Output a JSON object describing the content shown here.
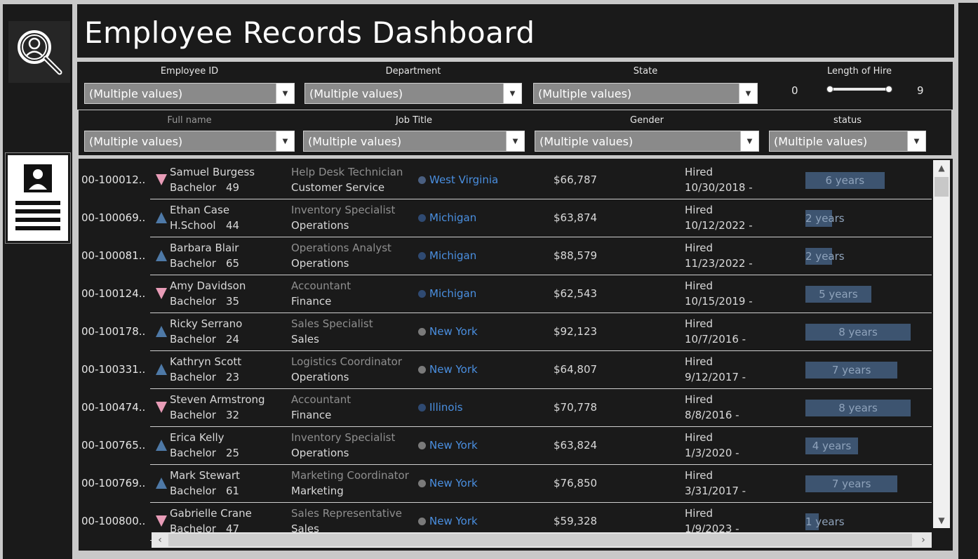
{
  "title": "Employee Records Dashboard",
  "filters": {
    "employee_id": {
      "label": "Employee ID",
      "value": "(Multiple values)"
    },
    "department": {
      "label": "Department",
      "value": "(Multiple values)"
    },
    "state": {
      "label": "State",
      "value": "(Multiple values)"
    },
    "length_of_hire": {
      "label": "Length of Hire",
      "min": "0",
      "max": "9",
      "range_fraction": [
        0,
        1
      ]
    },
    "full_name": {
      "label": "Full name",
      "value": "(Multiple values)"
    },
    "job_title": {
      "label": "Job Title",
      "value": "(Multiple values)"
    },
    "gender": {
      "label": "Gender",
      "value": "(Multiple values)"
    },
    "status": {
      "label": "status",
      "value": "(Multiple values)"
    }
  },
  "colors": {
    "male": "#4e79a7",
    "female": "#e89cb7",
    "state_link": "#4a8fe0",
    "bar": "#3d5470"
  },
  "rows": [
    {
      "id": "00-100012..",
      "gender": "female",
      "name": "Samuel Burgess",
      "edu": "Bachelor",
      "age": "49",
      "job": "Help Desk Technician",
      "dept": "Customer Service",
      "state": "West Virginia",
      "dot": "#4a5f80",
      "salary": "$66,787",
      "status": "Hired",
      "date": "10/30/2018 -",
      "tenure": "6 years",
      "tenure_val": 6
    },
    {
      "id": "00-100069..",
      "gender": "male",
      "name": "Ethan Case",
      "edu": "H.School",
      "age": "44",
      "job": "Inventory Specialist",
      "dept": "Operations",
      "state": "Michigan",
      "dot": "#2f4a72",
      "salary": "$63,874",
      "status": "Hired",
      "date": "10/12/2022 -",
      "tenure": "2 years",
      "tenure_val": 2
    },
    {
      "id": "00-100081..",
      "gender": "male",
      "name": "Barbara Blair",
      "edu": "Bachelor",
      "age": "65",
      "job": "Operations Analyst",
      "dept": "Operations",
      "state": "Michigan",
      "dot": "#2f4a72",
      "salary": "$88,579",
      "status": "Hired",
      "date": "11/23/2022 -",
      "tenure": "2 years",
      "tenure_val": 2
    },
    {
      "id": "00-100124..",
      "gender": "female",
      "name": "Amy Davidson",
      "edu": "Bachelor",
      "age": "35",
      "job": "Accountant",
      "dept": "Finance",
      "state": "Michigan",
      "dot": "#2f4a72",
      "salary": "$62,543",
      "status": "Hired",
      "date": "10/15/2019 -",
      "tenure": "5 years",
      "tenure_val": 5
    },
    {
      "id": "00-100178..",
      "gender": "male",
      "name": "Ricky Serrano",
      "edu": "Bachelor",
      "age": "24",
      "job": "Sales Specialist",
      "dept": "Sales",
      "state": "New York",
      "dot": "#7a7a7a",
      "salary": "$92,123",
      "status": "Hired",
      "date": "10/7/2016 -",
      "tenure": "8 years",
      "tenure_val": 8
    },
    {
      "id": "00-100331..",
      "gender": "male",
      "name": "Kathryn Scott",
      "edu": "Bachelor",
      "age": "23",
      "job": "Logistics Coordinator",
      "dept": "Operations",
      "state": "New York",
      "dot": "#7a7a7a",
      "salary": "$64,807",
      "status": "Hired",
      "date": "9/12/2017 -",
      "tenure": "7 years",
      "tenure_val": 7
    },
    {
      "id": "00-100474..",
      "gender": "female",
      "name": "Steven Armstrong",
      "edu": "Bachelor",
      "age": "32",
      "job": "Accountant",
      "dept": "Finance",
      "state": "Illinois",
      "dot": "#2f4a72",
      "salary": "$70,778",
      "status": "Hired",
      "date": "8/8/2016 -",
      "tenure": "8 years",
      "tenure_val": 8
    },
    {
      "id": "00-100765..",
      "gender": "male",
      "name": "Erica Kelly",
      "edu": "Bachelor",
      "age": "25",
      "job": "Inventory Specialist",
      "dept": "Operations",
      "state": "New York",
      "dot": "#7a7a7a",
      "salary": "$63,824",
      "status": "Hired",
      "date": "1/3/2020 -",
      "tenure": "4 years",
      "tenure_val": 4
    },
    {
      "id": "00-100769..",
      "gender": "male",
      "name": "Mark Stewart",
      "edu": "Bachelor",
      "age": "61",
      "job": "Marketing Coordinator",
      "dept": "Marketing",
      "state": "New York",
      "dot": "#7a7a7a",
      "salary": "$76,850",
      "status": "Hired",
      "date": "3/31/2017 -",
      "tenure": "7 years",
      "tenure_val": 7
    },
    {
      "id": "00-100800..",
      "gender": "female",
      "name": "Gabrielle Crane",
      "edu": "Bachelor",
      "age": "47",
      "job": "Sales Representative",
      "dept": "Sales",
      "state": "New York",
      "dot": "#7a7a7a",
      "salary": "$59,328",
      "status": "Hired",
      "date": "1/9/2023 -",
      "tenure": "1 years",
      "tenure_val": 1
    }
  ]
}
